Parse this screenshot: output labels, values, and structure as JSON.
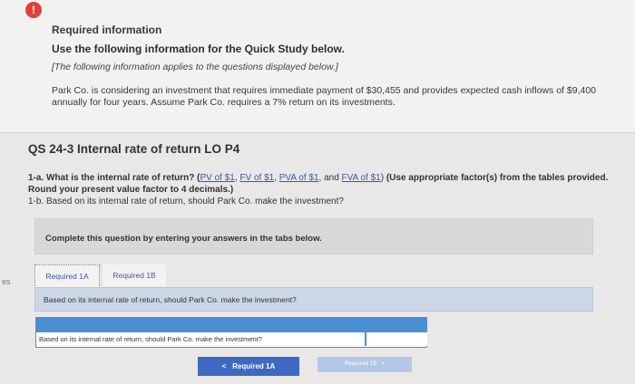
{
  "info": {
    "alert_symbol": "!",
    "heading": "Required information",
    "subheading": "Use the following information for the Quick Study below.",
    "note": "[The following information applies to the questions displayed below.]",
    "body": "Park Co. is considering an investment that requires immediate payment of $30,455 and provides expected cash inflows of $9,400 annually for four years. Assume Park Co. requires a 7% return on its investments."
  },
  "left_margin_text": "es",
  "question": {
    "title": "QS 24-3 Internal rate of return LO P4",
    "part_a_prefix": "1-a. What is the internal rate of return? (",
    "links": [
      "PV of $1",
      "FV of $1",
      "PVA of $1",
      "FVA of $1"
    ],
    "sep1": ", ",
    "sep2": ", ",
    "sep3": ", and ",
    "close_paren": ")",
    "instruction": " (Use appropriate factor(s) from the tables provided. Round your present value factor to 4 decimals.)",
    "part_b": "1-b. Based on its internal rate of return, should Park Co. make the investment?"
  },
  "complete_instruction": "Complete this question by entering your answers in the tabs below.",
  "tabs": [
    {
      "label": "Required 1A"
    },
    {
      "label": "Required 1B"
    }
  ],
  "answer_panel_text": "Based on its internal rate of return, should Park Co. make the investment?",
  "table": {
    "row_question": "Based on its internal rate of return, should Park Co. make the investment?",
    "row_answer": ""
  },
  "nav": {
    "prev_label": "Required 1A",
    "next_label": "Required 1B",
    "prev_arrow": "<",
    "next_arrow": ">"
  }
}
